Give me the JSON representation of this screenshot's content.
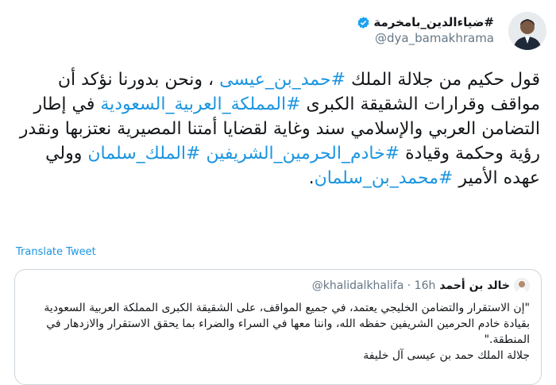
{
  "author": {
    "name": "#ضياءالدين_بامخرمة",
    "handle": "@dya_bamakhrama"
  },
  "tweet": {
    "segments": [
      {
        "t": "قول حكيم من جلالة الملك ",
        "tag": false
      },
      {
        "t": "#حمد_بن_عيسى",
        "tag": true
      },
      {
        "t": " ، ونحن بدورنا نؤكد أن مواقف وقرارات الشقيقة الكبرى ",
        "tag": false
      },
      {
        "t": "#المملكة_العربية_السعودية",
        "tag": true
      },
      {
        "t": " في إطار التضامن العربي والإسلامي سند وغاية لقضايا أمتنا المصيرية نعتزبها ونقدر رؤية وحكمة وقيادة ",
        "tag": false
      },
      {
        "t": "#خادم_الحرمين_الشريفين",
        "tag": true
      },
      {
        "t": " ",
        "tag": false
      },
      {
        "t": "#الملك_سلمان",
        "tag": true
      },
      {
        "t": " وولي عهده الأمير ",
        "tag": false
      },
      {
        "t": "#محمد_بن_سلمان",
        "tag": true
      },
      {
        "t": ".",
        "tag": false
      }
    ]
  },
  "translate_label": "Translate Tweet",
  "quote": {
    "name": "خالد بن أحمد",
    "handle": "@khalidalkhalifa",
    "sep": "·",
    "time": "16h",
    "text": "\"إن الاستقرار والتضامن الخليجي يعتمد، في جميع المواقف، على الشقيقة الكبرى المملكة العربية السعودية بقيادة خادم الحرمين الشريفين حفظه الله، واننا معها في السراء والضراء بما يحقق الاستقرار والازدهار في المنطقة.\"",
    "signature": "جلالة الملك حمد بن عيسى آل خليفة"
  },
  "icons": {
    "verified": "verified-badge-icon",
    "chevron": "chevron-down-icon"
  },
  "colors": {
    "accent": "#1b95e0",
    "text": "#14171a",
    "muted": "#657786",
    "border": "#ccd6dd"
  }
}
